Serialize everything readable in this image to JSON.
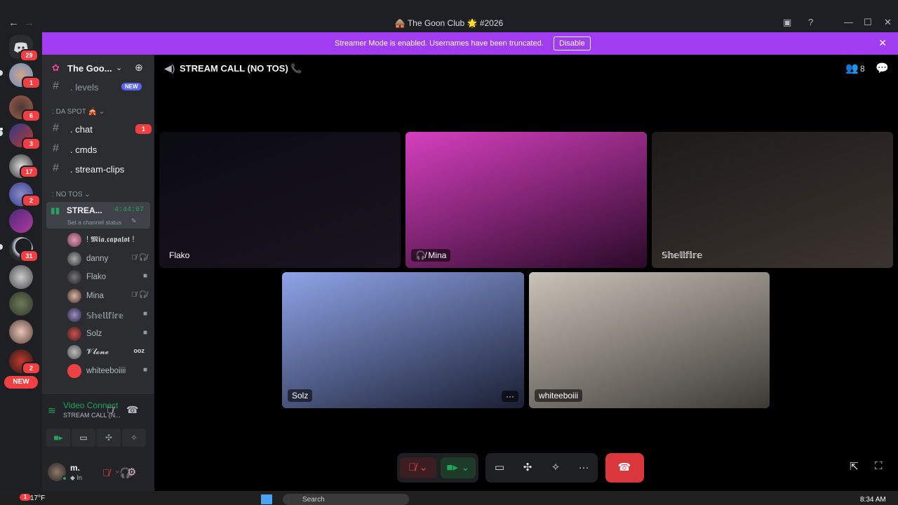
{
  "window": {
    "title": "🛖 The Goon Club 🌟 #2026",
    "back_icon": "arrow-left-icon",
    "forward_icon": "arrow-right-icon",
    "controls": [
      "inbox-icon",
      "help-icon",
      "minimize-icon",
      "maximize-icon",
      "close-icon"
    ]
  },
  "banner": {
    "message": "Streamer Mode is enabled. Usernames have been truncated.",
    "disable_label": "Disable",
    "color": "#a13cf0"
  },
  "rail": {
    "home_badge": "29",
    "servers": [
      {
        "badge": "1"
      },
      {
        "badge": "6"
      },
      {
        "badge": "3"
      },
      {
        "badge": "17"
      },
      {
        "badge": "2"
      },
      {
        "badge": ""
      },
      {
        "badge": "31"
      },
      {
        "badge": ""
      },
      {
        "badge": ""
      },
      {
        "badge": ""
      },
      {
        "badge": "2"
      }
    ],
    "new_label": "NEW"
  },
  "sidebar": {
    "server_name": "The Goo...",
    "channels_top": [
      {
        "label": "levels",
        "tag": "NEW"
      }
    ],
    "category_1": "DA SPOT 🎪",
    "channels": [
      {
        "label": "chat",
        "badge": "1"
      },
      {
        "label": "cmds"
      },
      {
        "label": "stream-clips"
      }
    ],
    "category_2": "NO TOS",
    "voice_channel": {
      "name": "STREA...",
      "timer": "4:44:07",
      "status_placeholder": "Set a channel status"
    },
    "voice_users": [
      {
        "name": "! 𝕸𝖎𝖆.𝖈𝖆𝖕𝖆𝖑𝖔𝖙 !",
        "icons": ""
      },
      {
        "name": "danny",
        "icons": "🎙̸ 🎧̸"
      },
      {
        "name": "Flako",
        "icons": "📹"
      },
      {
        "name": "Mina",
        "icons": "🎙̸ 🎧̸"
      },
      {
        "name": "𝕊𝕙𝕖𝕝𝕝𝕗𝕚𝕣𝕖",
        "icons": "📹"
      },
      {
        "name": "Solz",
        "icons": "📹"
      },
      {
        "name": "𝓥𝓵𝓸𝓷𝓮",
        "icons": "ooz"
      },
      {
        "name": "whiteeboiiii",
        "icons": "📹"
      }
    ]
  },
  "voice_status": {
    "title": "Video Connected",
    "channel": "STREAM CALL (N..."
  },
  "user_panel": {
    "username": "m.",
    "status": "In"
  },
  "stage": {
    "channel_title": "STREAM CALL (NO TOS) 📞",
    "member_count": "8",
    "tiles": [
      {
        "name": "Flako",
        "colors": [
          "#0b0b12",
          "#1a1420"
        ]
      },
      {
        "name": "Mina",
        "colors": [
          "#d63fbf",
          "#2a0a28"
        ]
      },
      {
        "name": "𝕊𝕙𝕖𝕝𝕝𝕗𝕚𝕣𝕖",
        "colors": [
          "#1d1a18",
          "#3b3430"
        ]
      },
      {
        "name": "Solz",
        "colors": [
          "#8fa4e8",
          "#1a1f33"
        ]
      },
      {
        "name": "whiteeboiii",
        "colors": [
          "#c9c2b8",
          "#3d3a36"
        ]
      }
    ]
  },
  "taskbar": {
    "weather": "17°F",
    "weather_badge": "1",
    "search_placeholder": "Search",
    "time": "8:34 AM"
  }
}
